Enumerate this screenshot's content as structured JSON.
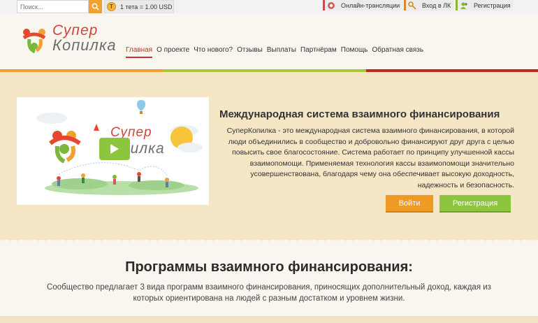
{
  "topbar": {
    "search_placeholder": "Поиск...",
    "rate_icon": "Т",
    "rate_text": "1 тета = 1.00 USD",
    "links": [
      {
        "label": "Онлайн-трансляции",
        "icon": "camera-icon",
        "color": "#c94c4c"
      },
      {
        "label": "Вход в ЛК",
        "icon": "key-icon",
        "color": "#d48a2c"
      },
      {
        "label": "Регистрация",
        "icon": "user-add-icon",
        "color": "#8ab52c"
      }
    ]
  },
  "logo": {
    "line1": "Супер",
    "line2": "Копилка"
  },
  "nav": [
    "Главная",
    "О проекте",
    "Что нового?",
    "Отзывы",
    "Выплаты",
    "Партнёрам",
    "Помощь",
    "Обратная связь"
  ],
  "colors": {
    "orange": "#f0a130",
    "green": "#a6c83a",
    "red": "#c02a24",
    "hero_bg": "#f5e6c6"
  },
  "video": {
    "line1": "Супер",
    "line2": "Копилка"
  },
  "hero": {
    "title": "Международная система взаимного финансирования",
    "text": "СуперКопилка - это международная система взаимного финансирования, в которой люди объединились в сообщество и добровольно финансируют друг друга с целью повысить свое благосостояние. Система работает по принципу улучшенной кассы взаимопомощи. Применяемая технология кассы взаимопомощи значительно усовершенствована, благодаря чему она обеспечивает высокую доходность, надежность и безопасность.",
    "login_label": "Войти",
    "register_label": "Регистрация"
  },
  "programs": {
    "title": "Программы взаимного финансирования:",
    "text": "Сообщество предлагает 3 вида программ взаимного финансирования, приносящих дополнительный доход, каждая из которых ориентирована на людей с разным достатком и уровнем жизни."
  }
}
